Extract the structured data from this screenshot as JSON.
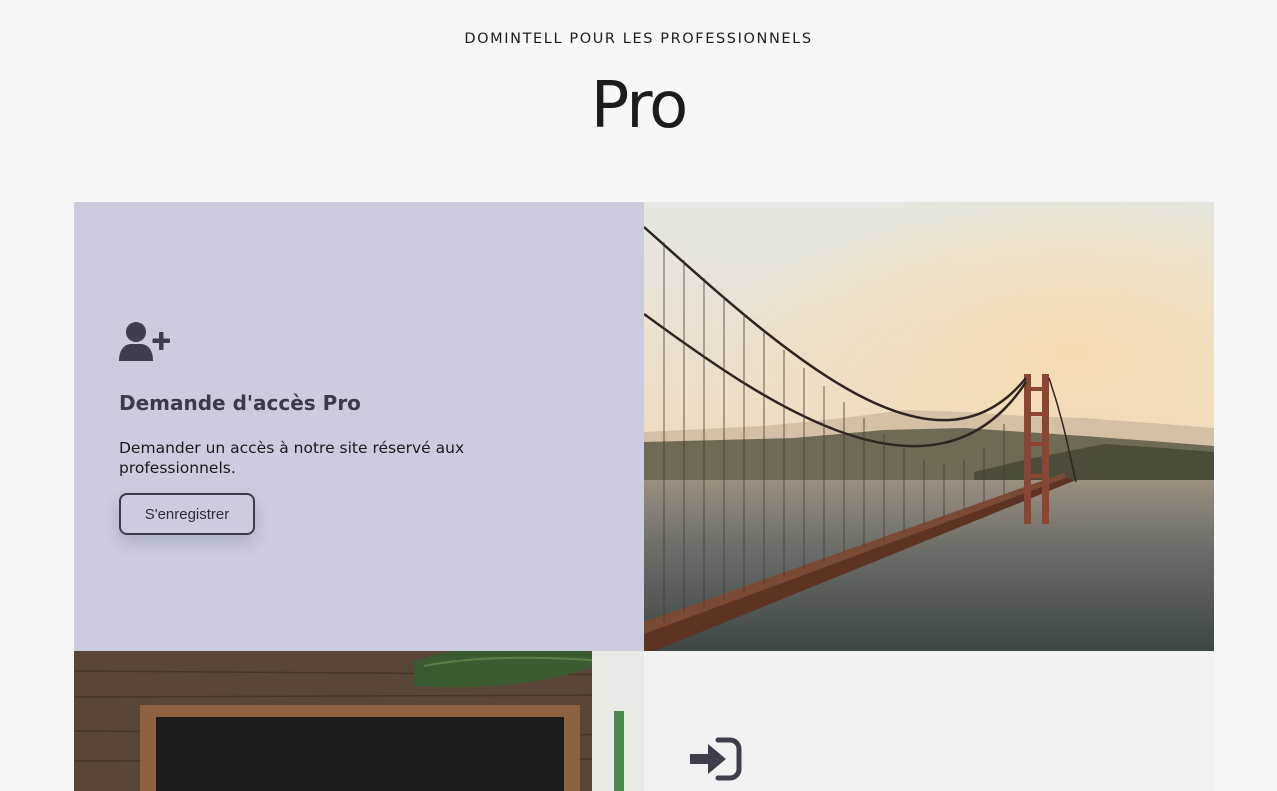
{
  "header": {
    "eyebrow": "DOMINTELL POUR LES PROFESSIONNELS",
    "title": "Pro"
  },
  "register_card": {
    "icon": "user-plus-icon",
    "title": "Demande d'accès Pro",
    "description": "Demander un accès à notre site réservé aux professionnels.",
    "button_label": "S'enregistrer",
    "background": "#cbcddf"
  },
  "login_card": {
    "icon": "sign-in-icon",
    "background": "#f2f2f2"
  },
  "colors": {
    "page_background": "#f7f7f7",
    "text_dark": "#1c1c1c",
    "accent_dark": "#3a3b48"
  }
}
